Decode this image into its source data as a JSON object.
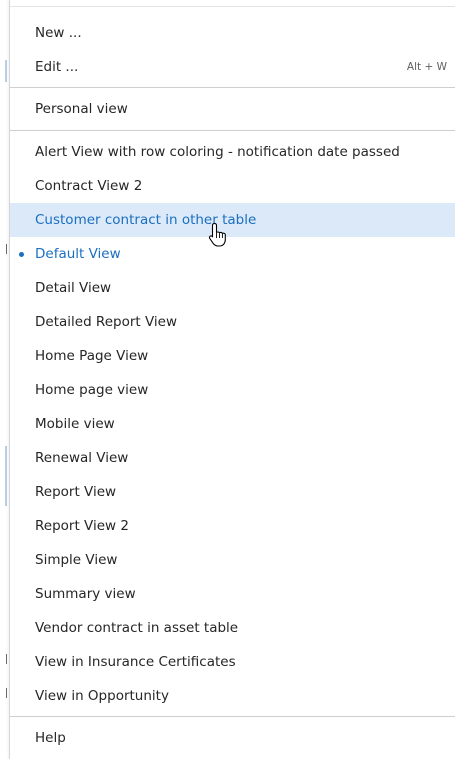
{
  "menu": {
    "actions": [
      {
        "label": "New ...",
        "shortcut": ""
      },
      {
        "label": "Edit ...",
        "shortcut": "Alt + W"
      }
    ],
    "personal_label": "Personal view",
    "views": [
      {
        "label": "Alert View with row coloring - notification date passed"
      },
      {
        "label": "Contract View 2"
      },
      {
        "label": "Customer contract in other table",
        "state": "hovered"
      },
      {
        "label": "Default View",
        "state": "selected"
      },
      {
        "label": "Detail View"
      },
      {
        "label": "Detailed Report View"
      },
      {
        "label": "Home Page View"
      },
      {
        "label": "Home page view"
      },
      {
        "label": "Mobile view"
      },
      {
        "label": "Renewal View"
      },
      {
        "label": "Report View"
      },
      {
        "label": "Report View 2"
      },
      {
        "label": "Simple View"
      },
      {
        "label": "Summary view"
      },
      {
        "label": "Vendor contract in asset table"
      },
      {
        "label": "View in Insurance Certificates"
      },
      {
        "label": "View in Opportunity"
      }
    ],
    "help_label": "Help"
  },
  "colors": {
    "accent": "#1b6fc1",
    "hover_background": "#dbe9f8",
    "text": "#262626"
  },
  "icons": {
    "cursor": "hand-pointer-cursor-icon",
    "selected_marker": "bullet-dot-icon"
  }
}
